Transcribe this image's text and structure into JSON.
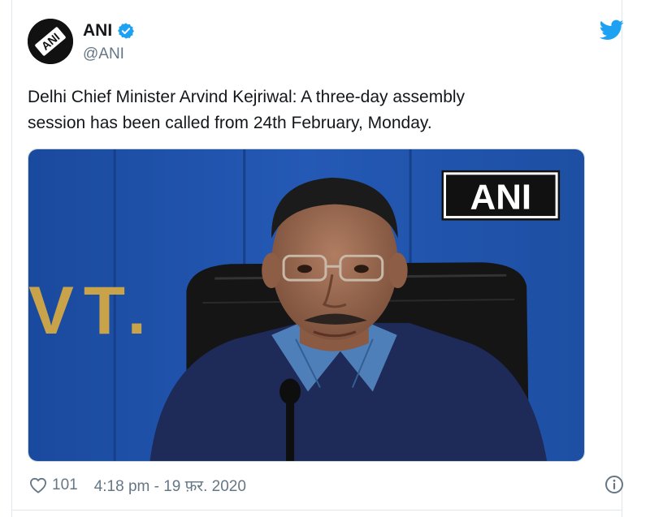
{
  "author": {
    "display_name": "ANI",
    "handle": "@ANI",
    "verified": true,
    "avatar_icon": "ani-logo-icon"
  },
  "tweet": {
    "text_line1": "Delhi Chief Minister Arvind Kejriwal: A three-day assembly",
    "text_line2": "session has been called from 24th February, Monday."
  },
  "media": {
    "watermark": "ANI",
    "backdrop_text": "VT. G"
  },
  "footer": {
    "like_count": "101",
    "timestamp": "4:18 pm - 19 फ़र. 2020"
  },
  "colors": {
    "twitter_blue": "#1da1f2",
    "secondary_text": "#657786",
    "primary_text": "#14171a",
    "media_backdrop": "#1d4fa3"
  }
}
